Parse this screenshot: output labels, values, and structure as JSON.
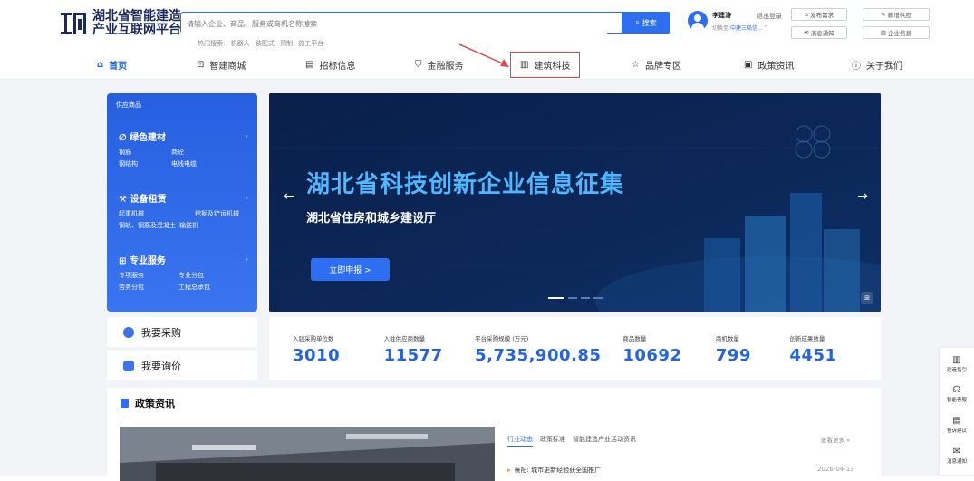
{
  "logo": {
    "line1": "湖北省智能建造",
    "line2": "产业互联网平台"
  },
  "search": {
    "placeholder": "请输入企业、商品、服务或商机名称搜索",
    "button": "搜索"
  },
  "hot": {
    "label": "热门搜索:",
    "items": [
      "机器人",
      "装配式",
      "预制",
      "施工平台"
    ]
  },
  "user": {
    "name": "李建涛",
    "logout": "退出登录",
    "switch_label": "切换至:",
    "switch_value": "中建三局信... ˅"
  },
  "tools": {
    "publish": "发布需求",
    "supply": "新增供应",
    "notice": "消息通知",
    "company": "企业信息"
  },
  "nav": [
    {
      "icon": "home-icon",
      "glyph": "⌂",
      "label": "首页"
    },
    {
      "icon": "smart-mall-icon",
      "glyph": "⊡",
      "label": "智建商城"
    },
    {
      "icon": "bidding-icon",
      "glyph": "▤",
      "label": "招标信息"
    },
    {
      "icon": "finance-icon",
      "glyph": "⛉",
      "label": "金融服务"
    },
    {
      "icon": "building-tech-icon",
      "glyph": "▥",
      "label": "建筑科技"
    },
    {
      "icon": "brand-icon",
      "glyph": "☆",
      "label": "品牌专区"
    },
    {
      "icon": "policy-icon",
      "glyph": "▣",
      "label": "政策资讯"
    },
    {
      "icon": "about-icon",
      "glyph": "ⓘ",
      "label": "关于我们"
    }
  ],
  "side": {
    "head": "供应商品",
    "green": {
      "title": "绿色建材",
      "glyph": "∅",
      "rows": [
        [
          "钢筋",
          "商砼"
        ],
        [
          "钢结构",
          "电线电缆"
        ]
      ]
    },
    "rent": {
      "title": "设备租赁",
      "glyph": "⚒",
      "rows": [
        [
          "起重机械",
          "挖掘及铲运机械"
        ],
        [
          "钢轨、钢筋及混凝土",
          "输送机"
        ]
      ]
    },
    "pro": {
      "title": "专业服务",
      "glyph": "⊞",
      "rows": [
        [
          "专项服务",
          "专业分包"
        ],
        [
          "劳务分包",
          "工程总承包"
        ]
      ]
    },
    "chev": "›"
  },
  "quick": {
    "purchase": "我要采购",
    "inquiry": "我要询价"
  },
  "banner": {
    "title": "湖北省科技创新企业信息征集",
    "subtitle": "湖北省住房和城乡建设厅",
    "button": "立即申报  >",
    "prev": "←",
    "next": "→",
    "corner": "⊞"
  },
  "stats": [
    {
      "label": "入驻采购单位数",
      "value": "3010"
    },
    {
      "label": "入驻供应商数量",
      "value": "11577"
    },
    {
      "label": "平台采购规模 (万元)",
      "value": "5,735,900.85"
    },
    {
      "label": "商品数量",
      "value": "10692"
    },
    {
      "label": "商机数量",
      "value": "799"
    },
    {
      "label": "创新成果数量",
      "value": "4451"
    }
  ],
  "policy": {
    "title": "政策资讯",
    "tabs": [
      "行业动态",
      "政策标准",
      "智能建造产业活动资讯"
    ],
    "more": "查看更多 »",
    "news": {
      "title": "襄阳: 城市更新经验获全国推广",
      "date": "2026-04-13"
    }
  },
  "float": [
    {
      "glyph": "▥",
      "label": "建造指引",
      "icon": "guide-icon"
    },
    {
      "glyph": "☊",
      "label": "智能客服",
      "icon": "service-icon"
    },
    {
      "glyph": "▤",
      "label": "投诉建议",
      "icon": "feedback-icon"
    },
    {
      "glyph": "✉",
      "label": "消息通知",
      "icon": "message-icon"
    }
  ],
  "colors": {
    "primary": "#2d6ff0",
    "banner_bg": "#0b2352",
    "highlight_box": "#e04848"
  }
}
